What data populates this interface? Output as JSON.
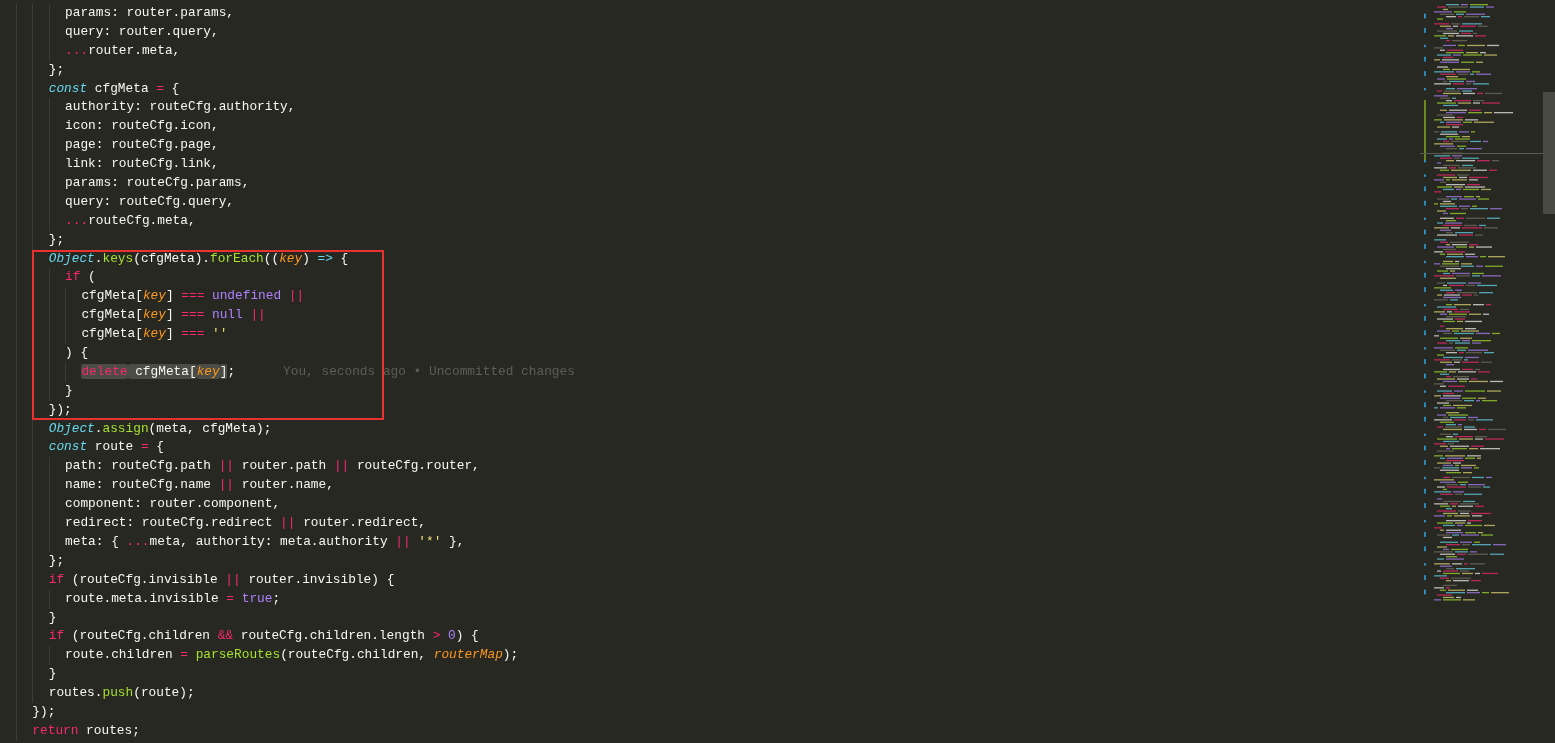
{
  "editor": {
    "blocks": [
      {
        "lines": [
          {
            "tokens": [
              {
                "text": "      params: router.params,",
                "kind": "plain"
              }
            ]
          },
          {
            "tokens": [
              {
                "text": "      query: router.query,",
                "kind": "plain"
              }
            ]
          },
          {
            "tokens": [
              {
                "text": "      ...",
                "kind": "operator"
              },
              {
                "text": "router.meta,",
                "kind": "plain"
              }
            ]
          },
          {
            "tokens": [
              {
                "text": "    };",
                "kind": "plain"
              }
            ]
          },
          {
            "tokens": [
              {
                "text": "    const",
                "kind": "storage"
              },
              {
                "text": " cfgMeta ",
                "kind": "plain"
              },
              {
                "text": "=",
                "kind": "operator"
              },
              {
                "text": " {",
                "kind": "plain"
              }
            ]
          },
          {
            "tokens": [
              {
                "text": "      authority: routeCfg.authority,",
                "kind": "plain"
              }
            ]
          },
          {
            "tokens": [
              {
                "text": "      icon: routeCfg.icon,",
                "kind": "plain"
              }
            ]
          },
          {
            "tokens": [
              {
                "text": "      page: routeCfg.page,",
                "kind": "plain"
              }
            ]
          },
          {
            "tokens": [
              {
                "text": "      link: routeCfg.link,",
                "kind": "plain"
              }
            ]
          },
          {
            "tokens": [
              {
                "text": "      params: routeCfg.params,",
                "kind": "plain"
              }
            ]
          },
          {
            "tokens": [
              {
                "text": "      query: routeCfg.query,",
                "kind": "plain"
              }
            ]
          },
          {
            "tokens": [
              {
                "text": "      ...",
                "kind": "operator"
              },
              {
                "text": "routeCfg.meta,",
                "kind": "plain"
              }
            ]
          },
          {
            "tokens": [
              {
                "text": "    };",
                "kind": "plain"
              }
            ]
          }
        ]
      },
      {
        "boxed": true,
        "lines": [
          {
            "tokens": [
              {
                "text": "    Object",
                "kind": "storage"
              },
              {
                "text": ".",
                "kind": "plain"
              },
              {
                "text": "keys",
                "kind": "function"
              },
              {
                "text": "(cfgMeta).",
                "kind": "plain"
              },
              {
                "text": "forEach",
                "kind": "function"
              },
              {
                "text": "((",
                "kind": "plain"
              },
              {
                "text": "key",
                "kind": "param"
              },
              {
                "text": ") ",
                "kind": "plain"
              },
              {
                "text": "=>",
                "kind": "arrow"
              },
              {
                "text": " {",
                "kind": "plain"
              }
            ]
          },
          {
            "tokens": [
              {
                "text": "      if",
                "kind": "keyword"
              },
              {
                "text": " (",
                "kind": "plain"
              }
            ]
          },
          {
            "tokens": [
              {
                "text": "        cfgMeta[",
                "kind": "plain"
              },
              {
                "text": "key",
                "kind": "param"
              },
              {
                "text": "] ",
                "kind": "plain"
              },
              {
                "text": "===",
                "kind": "operator"
              },
              {
                "text": " undefined",
                "kind": "constant"
              },
              {
                "text": " ||",
                "kind": "operator"
              }
            ]
          },
          {
            "tokens": [
              {
                "text": "        cfgMeta[",
                "kind": "plain"
              },
              {
                "text": "key",
                "kind": "param"
              },
              {
                "text": "] ",
                "kind": "plain"
              },
              {
                "text": "===",
                "kind": "operator"
              },
              {
                "text": " null",
                "kind": "constant"
              },
              {
                "text": " ||",
                "kind": "operator"
              }
            ]
          },
          {
            "tokens": [
              {
                "text": "        cfgMeta[",
                "kind": "plain"
              },
              {
                "text": "key",
                "kind": "param"
              },
              {
                "text": "] ",
                "kind": "plain"
              },
              {
                "text": "===",
                "kind": "operator"
              },
              {
                "text": " ''",
                "kind": "string"
              }
            ]
          },
          {
            "tokens": [
              {
                "text": "      ) {",
                "kind": "plain"
              }
            ]
          },
          {
            "tokens": [
              {
                "text": "        delete",
                "kind": "keyword",
                "highlighted": true
              },
              {
                "text": " cfgMeta[",
                "kind": "plain",
                "highlighted": true
              },
              {
                "text": "key",
                "kind": "param",
                "highlighted": true
              },
              {
                "text": "]",
                "kind": "plain",
                "highlighted": true
              },
              {
                "text": ";",
                "kind": "plain"
              }
            ],
            "blame": "You, seconds ago • Uncommitted changes"
          },
          {
            "tokens": [
              {
                "text": "      }",
                "kind": "plain"
              }
            ]
          },
          {
            "tokens": [
              {
                "text": "    });",
                "kind": "plain"
              }
            ]
          }
        ]
      },
      {
        "lines": [
          {
            "tokens": [
              {
                "text": "    Object",
                "kind": "storage"
              },
              {
                "text": ".",
                "kind": "plain"
              },
              {
                "text": "assign",
                "kind": "function"
              },
              {
                "text": "(meta, cfgMeta);",
                "kind": "plain"
              }
            ]
          },
          {
            "tokens": [
              {
                "text": "    const",
                "kind": "storage"
              },
              {
                "text": " route ",
                "kind": "plain"
              },
              {
                "text": "=",
                "kind": "operator"
              },
              {
                "text": " {",
                "kind": "plain"
              }
            ]
          },
          {
            "tokens": [
              {
                "text": "      path: routeCfg.path ",
                "kind": "plain"
              },
              {
                "text": "||",
                "kind": "operator"
              },
              {
                "text": " router.path ",
                "kind": "plain"
              },
              {
                "text": "||",
                "kind": "operator"
              },
              {
                "text": " routeCfg.router,",
                "kind": "plain"
              }
            ]
          },
          {
            "tokens": [
              {
                "text": "      name: routeCfg.name ",
                "kind": "plain"
              },
              {
                "text": "||",
                "kind": "operator"
              },
              {
                "text": " router.name,",
                "kind": "plain"
              }
            ]
          },
          {
            "tokens": [
              {
                "text": "      component: router.component,",
                "kind": "plain"
              }
            ]
          },
          {
            "tokens": [
              {
                "text": "      redirect: routeCfg.redirect ",
                "kind": "plain"
              },
              {
                "text": "||",
                "kind": "operator"
              },
              {
                "text": " router.redirect,",
                "kind": "plain"
              }
            ]
          },
          {
            "tokens": [
              {
                "text": "      meta: { ",
                "kind": "plain"
              },
              {
                "text": "...",
                "kind": "operator"
              },
              {
                "text": "meta, authority: meta.authority ",
                "kind": "plain"
              },
              {
                "text": "||",
                "kind": "operator"
              },
              {
                "text": " '*'",
                "kind": "string"
              },
              {
                "text": " },",
                "kind": "plain"
              }
            ]
          },
          {
            "tokens": [
              {
                "text": "    };",
                "kind": "plain"
              }
            ]
          },
          {
            "tokens": [
              {
                "text": "    if",
                "kind": "keyword"
              },
              {
                "text": " (routeCfg.invisible ",
                "kind": "plain"
              },
              {
                "text": "||",
                "kind": "operator"
              },
              {
                "text": " router.invisible) {",
                "kind": "plain"
              }
            ]
          },
          {
            "tokens": [
              {
                "text": "      route.meta.invisible ",
                "kind": "plain"
              },
              {
                "text": "=",
                "kind": "operator"
              },
              {
                "text": " true",
                "kind": "constant"
              },
              {
                "text": ";",
                "kind": "plain"
              }
            ]
          },
          {
            "tokens": [
              {
                "text": "    }",
                "kind": "plain"
              }
            ]
          },
          {
            "tokens": [
              {
                "text": "    if",
                "kind": "keyword"
              },
              {
                "text": " (routeCfg.children ",
                "kind": "plain"
              },
              {
                "text": "&&",
                "kind": "operator"
              },
              {
                "text": " routeCfg.children.length ",
                "kind": "plain"
              },
              {
                "text": ">",
                "kind": "operator"
              },
              {
                "text": " 0",
                "kind": "constant"
              },
              {
                "text": ") {",
                "kind": "plain"
              }
            ]
          },
          {
            "tokens": [
              {
                "text": "      route.children ",
                "kind": "plain"
              },
              {
                "text": "=",
                "kind": "operator"
              },
              {
                "text": " parseRoutes",
                "kind": "function"
              },
              {
                "text": "(routeCfg.children, ",
                "kind": "plain"
              },
              {
                "text": "routerMap",
                "kind": "param"
              },
              {
                "text": ");",
                "kind": "plain"
              }
            ]
          },
          {
            "tokens": [
              {
                "text": "    }",
                "kind": "plain"
              }
            ]
          },
          {
            "tokens": [
              {
                "text": "    routes.",
                "kind": "plain"
              },
              {
                "text": "push",
                "kind": "function"
              },
              {
                "text": "(route);",
                "kind": "plain"
              }
            ]
          },
          {
            "tokens": [
              {
                "text": "  });",
                "kind": "plain"
              }
            ]
          },
          {
            "tokens": [
              {
                "text": "  return",
                "kind": "keyword"
              },
              {
                "text": " routes;",
                "kind": "plain"
              }
            ]
          }
        ]
      }
    ]
  }
}
